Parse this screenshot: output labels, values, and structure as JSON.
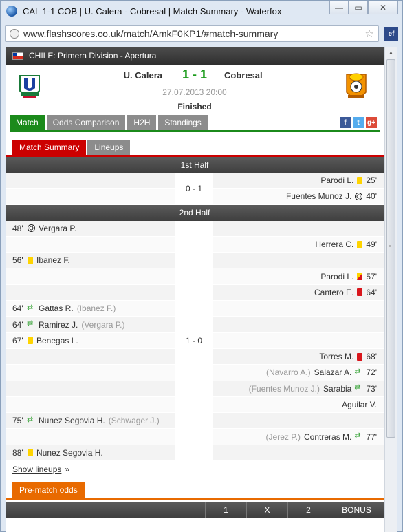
{
  "window": {
    "title": "CAL 1-1 COB | U. Calera - Cobresal | Match Summary - Waterfox",
    "minimize": "—",
    "maximize": "▭",
    "close": "✕"
  },
  "browser": {
    "url": "www.flashscores.co.uk/match/AmkF0KP1/#match-summary",
    "extension_label": "ef"
  },
  "league": {
    "name": "CHILE: Primera Division - Apertura"
  },
  "match": {
    "home": "U. Calera",
    "away": "Cobresal",
    "score": "1 - 1",
    "date": "27.07.2013 20:00",
    "status": "Finished"
  },
  "tabs": [
    "Match",
    "Odds Comparison",
    "H2H",
    "Standings"
  ],
  "share": [
    "f",
    "t",
    "g+"
  ],
  "subtabs": [
    "Match Summary",
    "Lineups"
  ],
  "first_half": {
    "label": "1st Half",
    "score": "0 - 1",
    "events": [
      {
        "side": "away",
        "minute": "25'",
        "icon": "yellow-card",
        "player": "Parodi L.",
        "assist": ""
      },
      {
        "side": "away",
        "minute": "40'",
        "icon": "goal",
        "player": "Fuentes Munoz J.",
        "assist": ""
      }
    ]
  },
  "second_half": {
    "label": "2nd Half",
    "score": "1 - 0",
    "events": [
      {
        "side": "home",
        "minute": "48'",
        "icon": "goal",
        "player": "Vergara P.",
        "assist": ""
      },
      {
        "side": "away",
        "minute": "49'",
        "icon": "yellow-card",
        "player": "Herrera C.",
        "assist": ""
      },
      {
        "side": "home",
        "minute": "56'",
        "icon": "yellow-card",
        "player": "Ibanez F.",
        "assist": ""
      },
      {
        "side": "away",
        "minute": "57'",
        "icon": "yellow-red-card",
        "player": "Parodi L.",
        "assist": ""
      },
      {
        "side": "away",
        "minute": "64'",
        "icon": "red-card",
        "player": "Cantero E.",
        "assist": ""
      },
      {
        "side": "home",
        "minute": "64'",
        "icon": "substitution",
        "player": "Gattas R.",
        "assist": "(Ibanez F.)"
      },
      {
        "side": "home",
        "minute": "64'",
        "icon": "substitution",
        "player": "Ramirez J.",
        "assist": "(Vergara P.)"
      },
      {
        "side": "home",
        "minute": "67'",
        "icon": "yellow-card",
        "player": "Benegas L.",
        "assist": ""
      },
      {
        "side": "away",
        "minute": "68'",
        "icon": "red-card",
        "player": "Torres M.",
        "assist": ""
      },
      {
        "side": "away",
        "minute": "72'",
        "icon": "substitution",
        "player": "Salazar A.",
        "assist": "(Navarro A.)"
      },
      {
        "side": "away",
        "minute": "73'",
        "icon": "substitution",
        "player": "Sarabia",
        "assist": "(Fuentes Munoz J.)",
        "player2": "Aguilar V."
      },
      {
        "side": "home",
        "minute": "75'",
        "icon": "substitution",
        "player": "Nunez Segovia H.",
        "assist": "(Schwager J.)"
      },
      {
        "side": "away",
        "minute": "77'",
        "icon": "substitution",
        "player": "Contreras M.",
        "assist": "(Jerez P.)"
      },
      {
        "side": "home",
        "minute": "88'",
        "icon": "yellow-card",
        "player": "Nunez Segovia H.",
        "assist": ""
      }
    ]
  },
  "show_lineups": "Show lineups",
  "show_lineups_arrow": "»",
  "odds": {
    "tab": "Pre-match odds",
    "columns": [
      "1",
      "X",
      "2",
      "BONUS"
    ]
  }
}
